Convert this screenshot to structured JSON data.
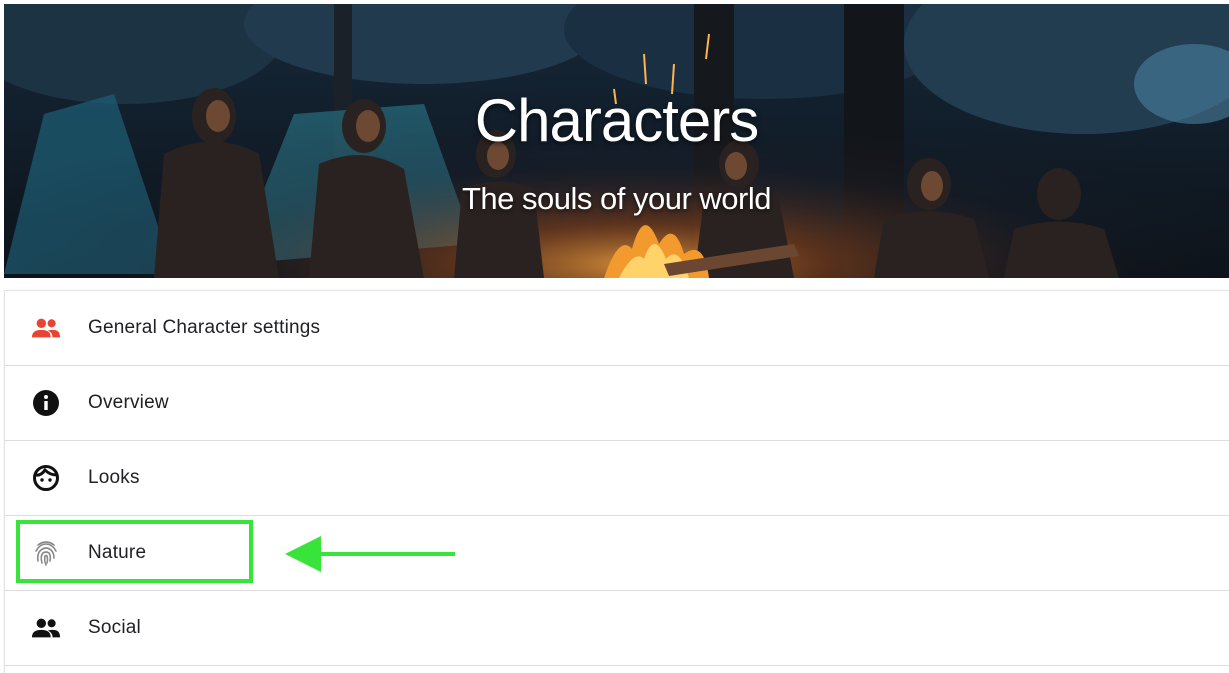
{
  "header": {
    "title": "Characters",
    "subtitle": "The souls of your world",
    "background_image": "campfire-people-photo"
  },
  "menu": {
    "items": [
      {
        "label": "General Character settings",
        "icon": "group-icon",
        "icon_color": "#e94335"
      },
      {
        "label": "Overview",
        "icon": "info-icon",
        "icon_color": "#111111"
      },
      {
        "label": "Looks",
        "icon": "face-icon",
        "icon_color": "#111111"
      },
      {
        "label": "Nature",
        "icon": "fingerprint-icon",
        "icon_color": "#8a8a8a"
      },
      {
        "label": "Social",
        "icon": "people-icon",
        "icon_color": "#111111"
      }
    ]
  },
  "annotation": {
    "highlight_color": "#39e43a",
    "highlighted_item": "Nature",
    "arrow": "left-arrow"
  }
}
